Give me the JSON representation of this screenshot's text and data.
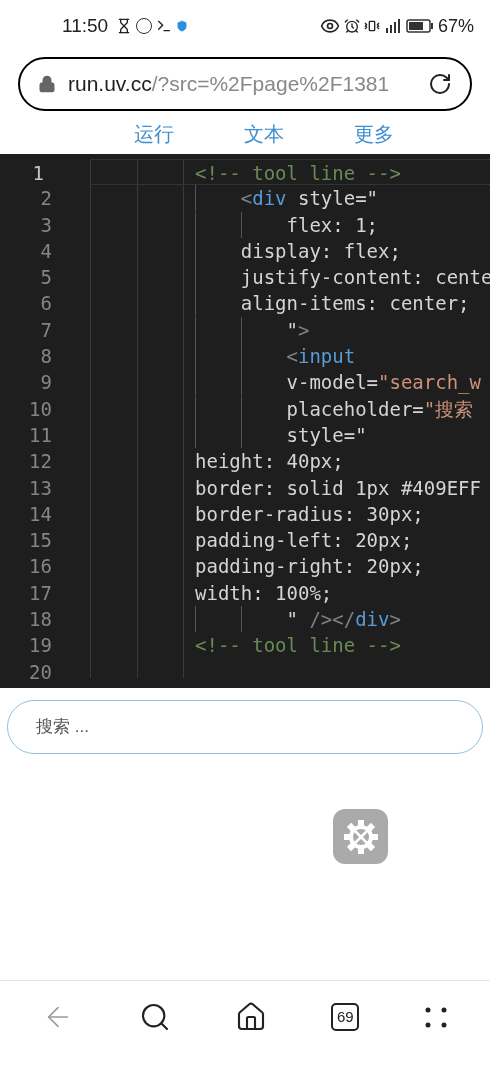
{
  "status_bar": {
    "time": "11:50",
    "battery": "67%"
  },
  "address_bar": {
    "host": "run.uv.cc",
    "path": "/?src=%2Fpage%2F1381"
  },
  "tabs": [
    {
      "label": "运行"
    },
    {
      "label": "文本"
    },
    {
      "label": "更多"
    }
  ],
  "code_editor": {
    "lines": [
      {
        "number": "1",
        "current": true,
        "segments": [
          {
            "kind": "comment",
            "text": "<!-- tool line -->"
          }
        ]
      },
      {
        "number": "2",
        "current": false,
        "segments": [
          {
            "kind": "bracket",
            "text": "    <"
          },
          {
            "kind": "tag",
            "text": "div"
          },
          {
            "kind": "text",
            "text": " style=\""
          }
        ]
      },
      {
        "number": "3",
        "current": false,
        "segments": [
          {
            "kind": "text",
            "text": "        flex: 1;"
          }
        ]
      },
      {
        "number": "4",
        "current": false,
        "segments": [
          {
            "kind": "text",
            "text": "    display: flex;"
          }
        ]
      },
      {
        "number": "5",
        "current": false,
        "segments": [
          {
            "kind": "text",
            "text": "    justify-content: cente"
          }
        ]
      },
      {
        "number": "6",
        "current": false,
        "segments": [
          {
            "kind": "text",
            "text": "    align-items: center;"
          }
        ]
      },
      {
        "number": "7",
        "current": false,
        "segments": [
          {
            "kind": "text",
            "text": "        \""
          },
          {
            "kind": "bracket",
            "text": ">"
          }
        ]
      },
      {
        "number": "8",
        "current": false,
        "segments": [
          {
            "kind": "bracket",
            "text": "        <"
          },
          {
            "kind": "tag",
            "text": "input"
          }
        ]
      },
      {
        "number": "9",
        "current": false,
        "segments": [
          {
            "kind": "text",
            "text": "        v-model="
          },
          {
            "kind": "string",
            "text": "\"search_w"
          }
        ]
      },
      {
        "number": "10",
        "current": false,
        "segments": [
          {
            "kind": "text",
            "text": "        placeholder="
          },
          {
            "kind": "string",
            "text": "\"搜索"
          }
        ]
      },
      {
        "number": "11",
        "current": false,
        "segments": [
          {
            "kind": "text",
            "text": "        style=\""
          }
        ]
      },
      {
        "number": "12",
        "current": false,
        "segments": [
          {
            "kind": "text",
            "text": "height: 40px;"
          }
        ]
      },
      {
        "number": "13",
        "current": false,
        "segments": [
          {
            "kind": "text",
            "text": "border: solid 1px #409EFF"
          }
        ]
      },
      {
        "number": "14",
        "current": false,
        "segments": [
          {
            "kind": "text",
            "text": "border-radius: 30px;"
          }
        ]
      },
      {
        "number": "15",
        "current": false,
        "segments": [
          {
            "kind": "text",
            "text": "padding-left: 20px;"
          }
        ]
      },
      {
        "number": "16",
        "current": false,
        "segments": [
          {
            "kind": "text",
            "text": "padding-right: 20px;"
          }
        ]
      },
      {
        "number": "17",
        "current": false,
        "segments": [
          {
            "kind": "text",
            "text": "width: 100%;"
          }
        ]
      },
      {
        "number": "18",
        "current": false,
        "segments": [
          {
            "kind": "text",
            "text": "        \" "
          },
          {
            "kind": "bracket",
            "text": "/></"
          },
          {
            "kind": "tag",
            "text": "div"
          },
          {
            "kind": "bracket",
            "text": ">"
          }
        ]
      },
      {
        "number": "19",
        "current": false,
        "segments": [
          {
            "kind": "comment",
            "text": "<!-- tool line -->"
          }
        ]
      },
      {
        "number": "20",
        "current": false
      }
    ]
  },
  "search_field": {
    "placeholder": "搜索 ..."
  },
  "bottom_nav": {
    "tab_count": "69"
  }
}
